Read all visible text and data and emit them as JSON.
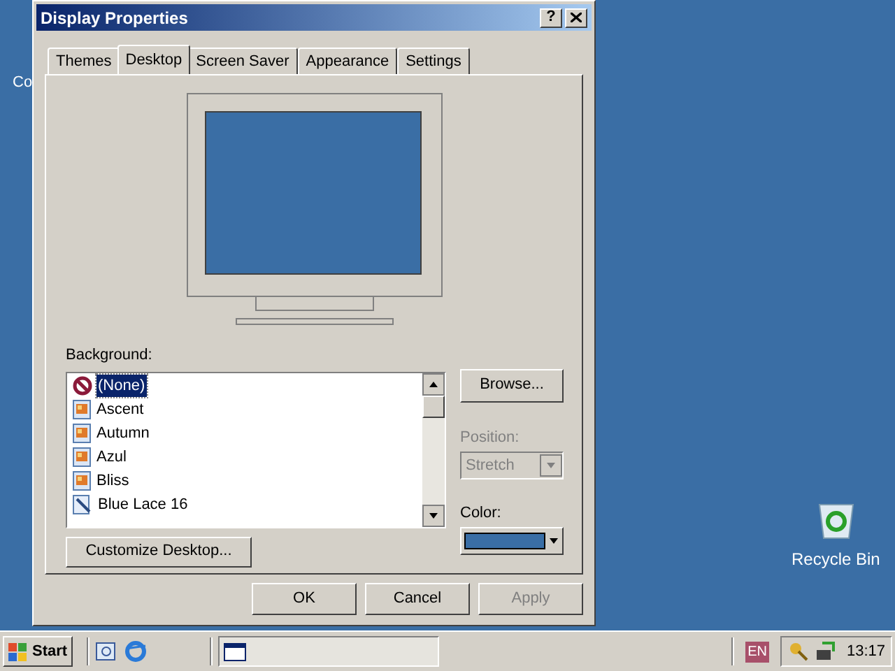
{
  "desktop_icons": [
    {
      "label": "Co",
      "kind": "partial"
    },
    {
      "label": "Recycle Bin",
      "kind": "recycle"
    }
  ],
  "window": {
    "title": "Display Properties",
    "help": "?"
  },
  "tabs": [
    {
      "label": "Themes",
      "selected": false
    },
    {
      "label": "Desktop",
      "selected": true
    },
    {
      "label": "Screen Saver",
      "selected": false
    },
    {
      "label": "Appearance",
      "selected": false
    },
    {
      "label": "Settings",
      "selected": false
    }
  ],
  "background": {
    "label": "Background:",
    "items": [
      {
        "label": "(None)",
        "kind": "none",
        "selected": true
      },
      {
        "label": "Ascent",
        "kind": "image",
        "selected": false
      },
      {
        "label": "Autumn",
        "kind": "image",
        "selected": false
      },
      {
        "label": "Azul",
        "kind": "image",
        "selected": false
      },
      {
        "label": "Bliss",
        "kind": "image",
        "selected": false
      },
      {
        "label": "Blue Lace 16",
        "kind": "pattern",
        "selected": false
      }
    ]
  },
  "browse_button": "Browse...",
  "position": {
    "label": "Position:",
    "value": "Stretch",
    "disabled": true
  },
  "color": {
    "label": "Color:",
    "color": "#3a6ea5"
  },
  "customize_button": "Customize Desktop...",
  "buttons": [
    {
      "label": "OK",
      "disabled": false
    },
    {
      "label": "Cancel",
      "disabled": false
    },
    {
      "label": "Apply",
      "disabled": true
    }
  ],
  "taskbar": {
    "start": "Start",
    "language": "EN",
    "clock": "13:17"
  }
}
